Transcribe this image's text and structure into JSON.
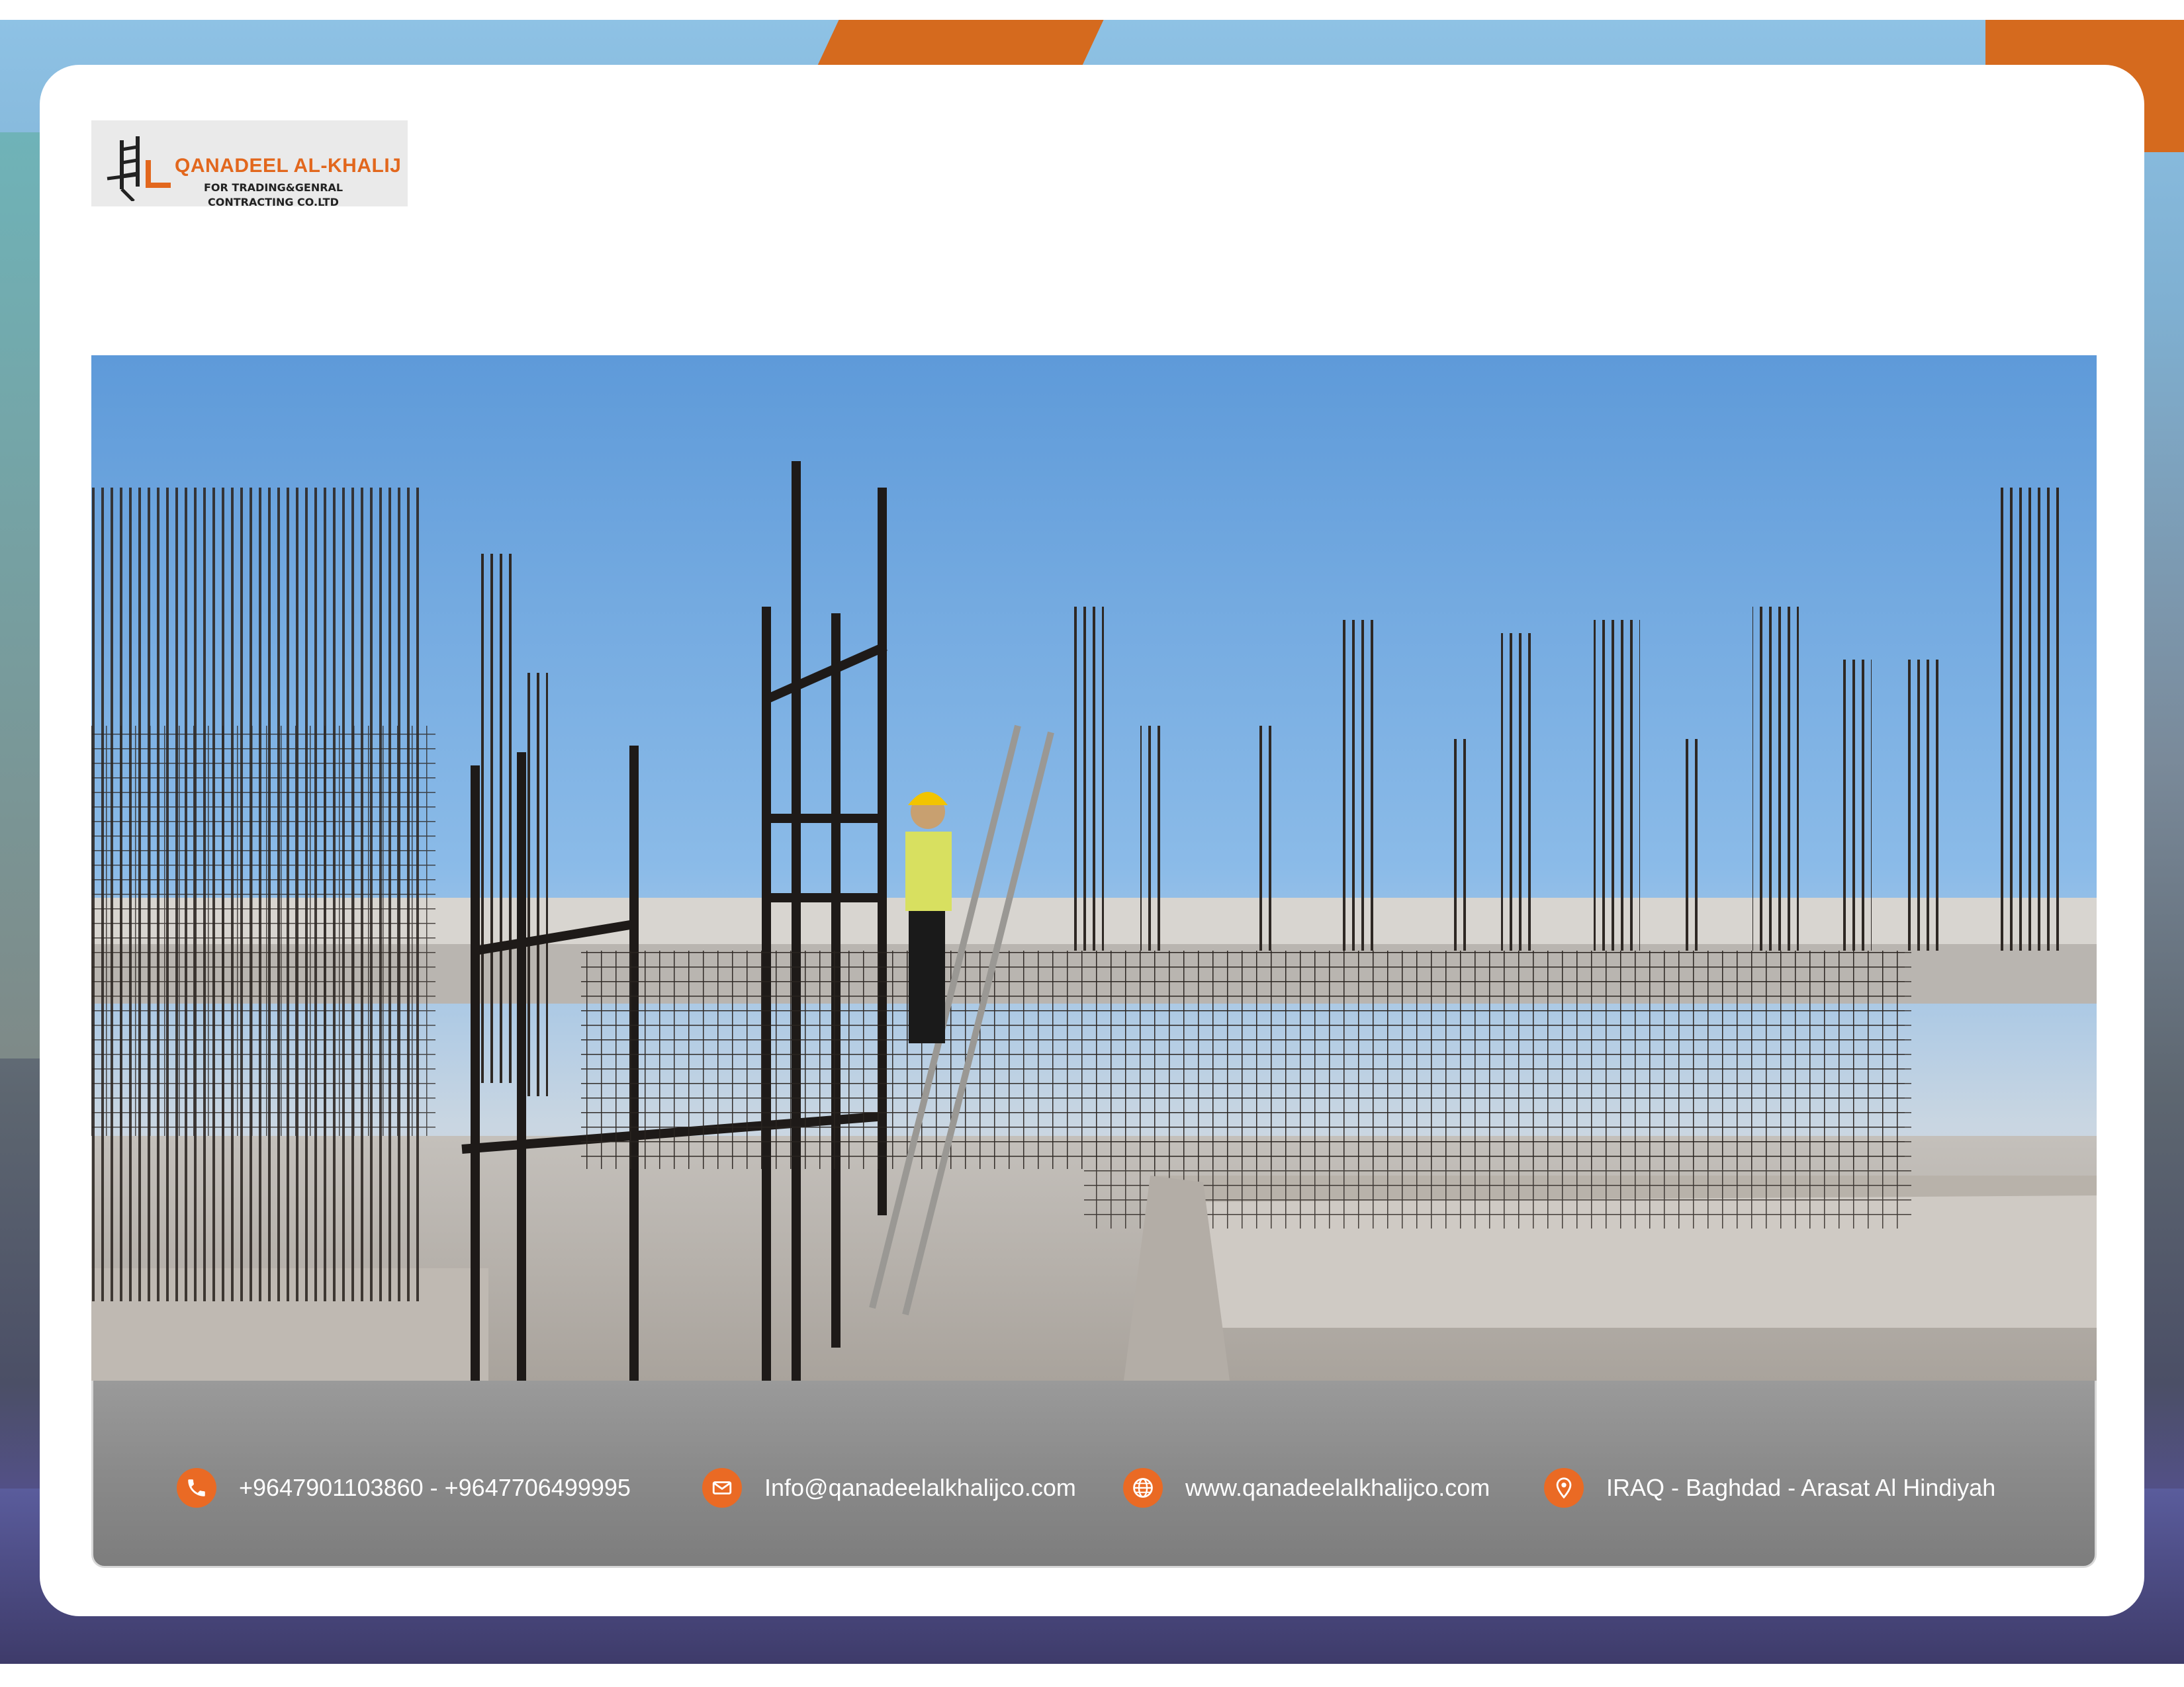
{
  "brand": {
    "name": "QANADEEL AL-KHALIJ",
    "tagline_line1": "FOR TRADING&GENRAL",
    "tagline_line2": "CONTRACTING CO.LTD",
    "accent_color": "#e2671d"
  },
  "photo": {
    "subject": "construction-site",
    "icon": "construction-photo"
  },
  "contacts": {
    "phone": {
      "icon": "phone-icon",
      "text": "+9647901103860 - +9647706499995"
    },
    "email": {
      "icon": "mail-icon",
      "text": "Info@qanadeelalkhalijco.com"
    },
    "website": {
      "icon": "globe-icon",
      "text": "www.qanadeelalkhalijco.com"
    },
    "address": {
      "icon": "location-pin-icon",
      "text": "IRAQ - Baghdad - Arasat Al Hindiyah"
    },
    "icon_color": "#ea6a24"
  }
}
